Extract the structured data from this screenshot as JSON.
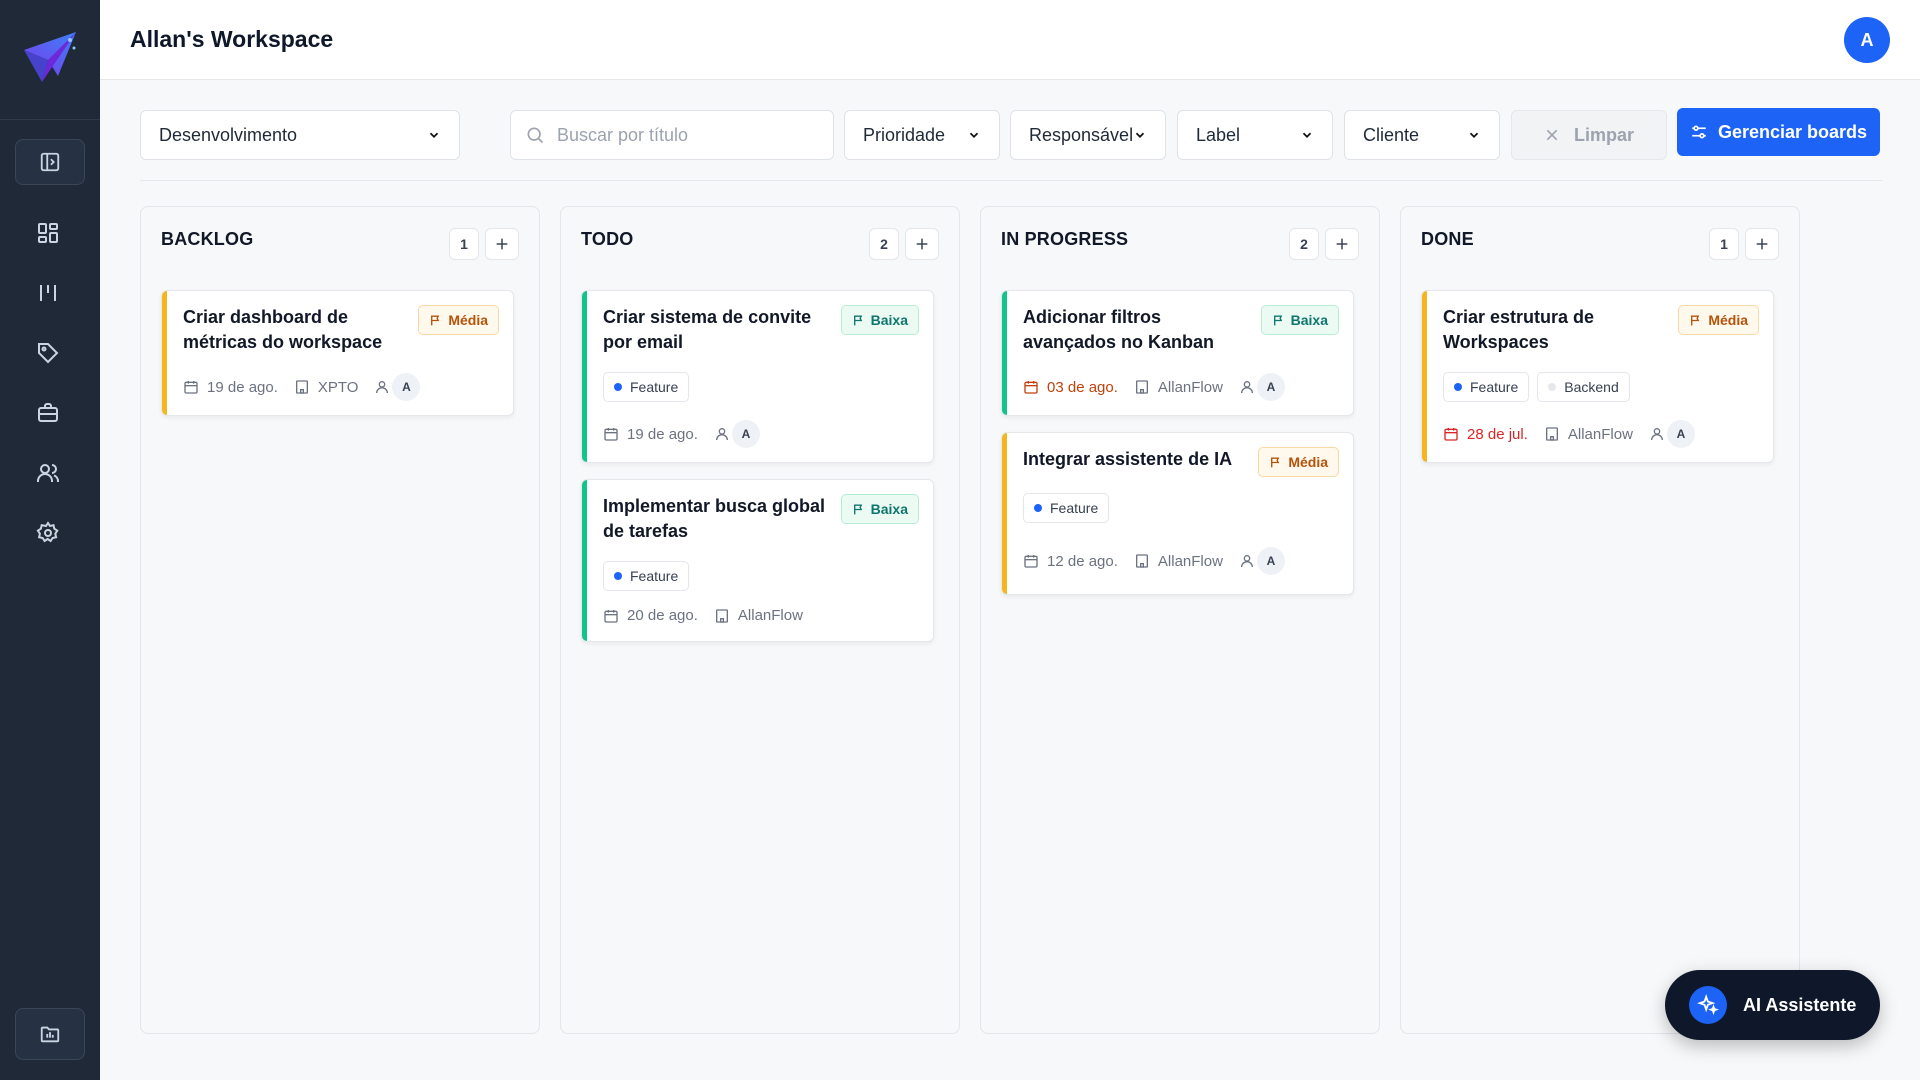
{
  "workspace": {
    "title": "Allan's Workspace",
    "avatar_initial": "A"
  },
  "sidebar": {
    "items": [
      {
        "icon": "panel-toggle-icon"
      },
      {
        "icon": "dashboard-icon"
      },
      {
        "icon": "kanban-icon"
      },
      {
        "icon": "tag-icon"
      },
      {
        "icon": "briefcase-icon"
      },
      {
        "icon": "users-icon"
      },
      {
        "icon": "settings-icon"
      },
      {
        "icon": "folder-chart-icon"
      }
    ]
  },
  "filters": {
    "board": "Desenvolvimento",
    "search_placeholder": "Buscar por título",
    "priority": "Prioridade",
    "assignee": "Responsável",
    "label": "Label",
    "client": "Cliente",
    "clear_label": "Limpar",
    "manage_label": "Gerenciar boards"
  },
  "columns": [
    {
      "title": "BACKLOG",
      "count": "1",
      "cards": [
        {
          "title": "Criar dashboard de métricas do workspace",
          "priority": "Média",
          "date": "19 de ago.",
          "client": "XPTO",
          "assignee": "A"
        }
      ]
    },
    {
      "title": "TODO",
      "count": "2",
      "cards": [
        {
          "title": "Criar sistema de convite por email",
          "priority": "Baixa",
          "tags": [
            "Feature"
          ],
          "date": "19 de ago.",
          "assignee": "A"
        },
        {
          "title": "Implementar busca global de tarefas",
          "priority": "Baixa",
          "tags": [
            "Feature"
          ],
          "date": "20 de ago.",
          "client": "AllanFlow"
        }
      ]
    },
    {
      "title": "IN PROGRESS",
      "count": "2",
      "cards": [
        {
          "title": "Adicionar filtros avançados no Kanban",
          "priority": "Baixa",
          "date": "03 de ago.",
          "client": "AllanFlow",
          "assignee": "A"
        },
        {
          "title": "Integrar assistente de IA",
          "priority": "Média",
          "tags": [
            "Feature"
          ],
          "date": "12 de ago.",
          "client": "AllanFlow",
          "assignee": "A"
        }
      ]
    },
    {
      "title": "DONE",
      "count": "1",
      "cards": [
        {
          "title": "Criar estrutura de Workspaces",
          "priority": "Média",
          "tags": [
            "Feature",
            "Backend"
          ],
          "date": "28 de jul.",
          "client": "AllanFlow",
          "assignee": "A"
        }
      ]
    }
  ],
  "ai_assistant": {
    "label": "AI Assistente"
  },
  "colors": {
    "accent": "#1d63f5",
    "sidebar": "#1f2937",
    "media": "#f5b520",
    "baixa": "#10c48a",
    "overdue": "#dc2626",
    "warning": "#c2410c"
  }
}
